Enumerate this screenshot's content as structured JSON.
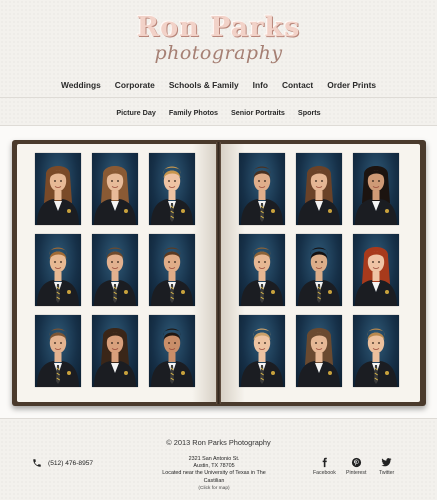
{
  "logo": {
    "main": "Ron Parks",
    "sub": "photography"
  },
  "nav_primary": [
    "Weddings",
    "Corporate",
    "Schools & Family",
    "Info",
    "Contact",
    "Order Prints"
  ],
  "nav_secondary": [
    "Picture Day",
    "Family Photos",
    "Senior Portraits",
    "Sports"
  ],
  "gallery": {
    "left_page": [
      {
        "hair": "#7a4a28",
        "skin": "#e7b996",
        "outfit": "blazer-f"
      },
      {
        "hair": "#8a5a34",
        "skin": "#e8bb99",
        "outfit": "blazer-f"
      },
      {
        "hair": "#c7964d",
        "skin": "#eec3a3",
        "outfit": "blazer-m"
      },
      {
        "hair": "#a06a34",
        "skin": "#e7b993",
        "outfit": "blazer-m"
      },
      {
        "hair": "#6e4a2c",
        "skin": "#e2b18f",
        "outfit": "blazer-m"
      },
      {
        "hair": "#5a3a22",
        "skin": "#e0ad88",
        "outfit": "blazer-m"
      },
      {
        "hair": "#7a5434",
        "skin": "#e3b390",
        "outfit": "blazer-m"
      },
      {
        "hair": "#3a2618",
        "skin": "#d8a07c",
        "outfit": "blazer-f"
      },
      {
        "hair": "#1f1712",
        "skin": "#c98e69",
        "outfit": "blazer-m"
      }
    ],
    "right_page": [
      {
        "hair": "#4a3020",
        "skin": "#e0ae8b",
        "outfit": "blazer-m"
      },
      {
        "hair": "#6a4228",
        "skin": "#e5b694",
        "outfit": "blazer-f"
      },
      {
        "hair": "#1c1410",
        "skin": "#cf9a76",
        "outfit": "blazer-f"
      },
      {
        "hair": "#8a6238",
        "skin": "#e6b793",
        "outfit": "blazer-m"
      },
      {
        "hair": "#141010",
        "skin": "#dcae8a",
        "outfit": "blazer-m"
      },
      {
        "hair": "#a83a1c",
        "skin": "#efc4a5",
        "outfit": "blazer-f"
      },
      {
        "hair": "#c9a06a",
        "skin": "#edc3a2",
        "outfit": "blazer-m"
      },
      {
        "hair": "#6a4a30",
        "skin": "#e6b895",
        "outfit": "blazer-f"
      },
      {
        "hair": "#b8884e",
        "skin": "#ecc09d",
        "outfit": "blazer-m"
      }
    ]
  },
  "footer": {
    "copyright": "© 2013 Ron Parks Photography",
    "phone": "(512) 476-8957",
    "address_lines": [
      "2321 San Antonio St.",
      "Austin, TX 78705",
      "Located near the University of Texas in The",
      "Castilian"
    ],
    "address_hint": "(Click for map)",
    "social": [
      {
        "label": "Facebook",
        "icon": "facebook-icon"
      },
      {
        "label": "Pinterest",
        "icon": "pinterest-icon"
      },
      {
        "label": "Twitter",
        "icon": "twitter-icon"
      }
    ]
  }
}
